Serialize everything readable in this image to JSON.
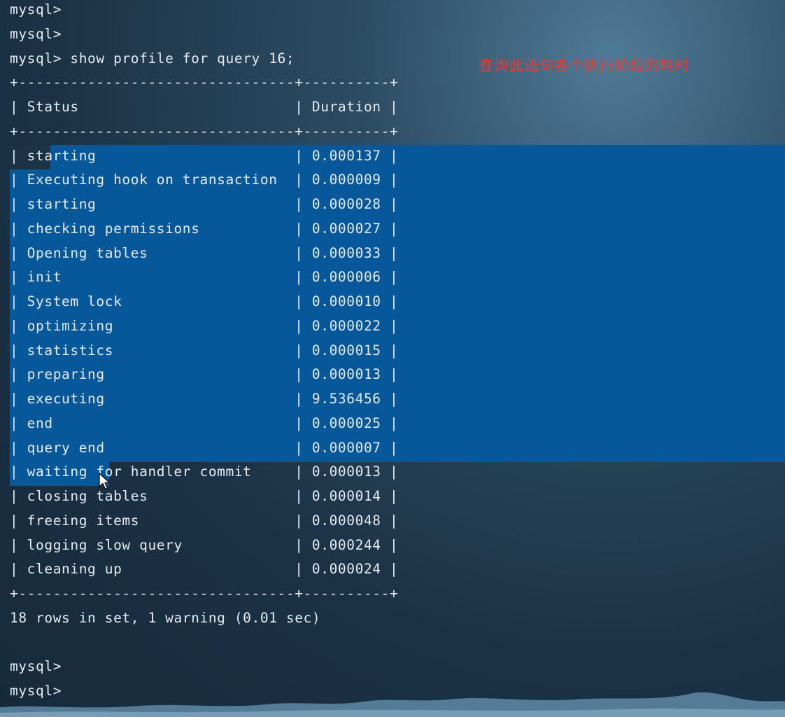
{
  "terminal": {
    "prompt": "mysql>",
    "lines_before": [
      "mysql>",
      "mysql>"
    ],
    "command": "mysql> show profile for query 16;",
    "border": "+--------------------------------+----------+",
    "header": "| Status                         | Duration |",
    "rows": [
      {
        "status": "starting",
        "duration": "0.000137"
      },
      {
        "status": "Executing hook on transaction",
        "duration": "0.000009"
      },
      {
        "status": "starting",
        "duration": "0.000028"
      },
      {
        "status": "checking permissions",
        "duration": "0.000027"
      },
      {
        "status": "Opening tables",
        "duration": "0.000033"
      },
      {
        "status": "init",
        "duration": "0.000006"
      },
      {
        "status": "System lock",
        "duration": "0.000010"
      },
      {
        "status": "optimizing",
        "duration": "0.000022"
      },
      {
        "status": "statistics",
        "duration": "0.000015"
      },
      {
        "status": "preparing",
        "duration": "0.000013"
      },
      {
        "status": "executing",
        "duration": "9.536456"
      },
      {
        "status": "end",
        "duration": "0.000025"
      },
      {
        "status": "query end",
        "duration": "0.000007"
      },
      {
        "status": "waiting for handler commit",
        "duration": "0.000013"
      },
      {
        "status": "closing tables",
        "duration": "0.000014"
      },
      {
        "status": "freeing items",
        "duration": "0.000048"
      },
      {
        "status": "logging slow query",
        "duration": "0.000244"
      },
      {
        "status": "cleaning up",
        "duration": "0.000024"
      }
    ],
    "summary": "18 rows in set, 1 warning (0.01 sec)",
    "lines_after": [
      "mysql>",
      "mysql>"
    ]
  },
  "annotation": {
    "text": "查询此语句各个执行阶段的耗时",
    "color": "#ea3a33"
  },
  "selection": {
    "color": "#07589b",
    "selected_rows_from": 1,
    "selected_rows_to": 14
  },
  "icons": {
    "cursor": "mouse-pointer-icon"
  }
}
